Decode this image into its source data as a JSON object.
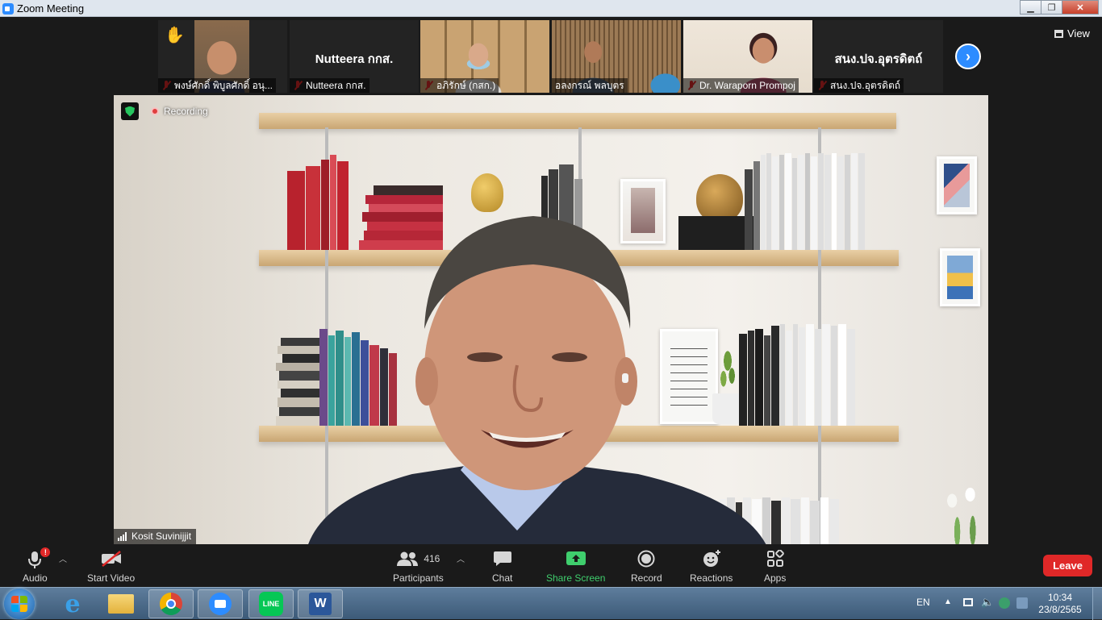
{
  "window": {
    "title": "Zoom Meeting",
    "min": "▁",
    "max": "❐",
    "close": "✕"
  },
  "gallery": {
    "tiles": [
      {
        "name": "พงษ์ศักดิ์ พิบูลศักดิ์ อนุ...",
        "type": "video",
        "hand_raised": true,
        "muted": true
      },
      {
        "name": "Nutteera กกส.",
        "display": "Nutteera กกส.",
        "type": "name",
        "muted": true
      },
      {
        "name": "อภิรักษ์ (กสก.)",
        "type": "video",
        "muted": true
      },
      {
        "name": "อลงกรณ์ พลบุตร",
        "type": "video",
        "muted": false
      },
      {
        "name": "Dr. Waraporn Prompoj",
        "type": "video",
        "muted": true
      },
      {
        "name": "สนง.ปจ.อุตรดิตถ์",
        "display": "สนง.ปจ.อุตรดิตถ์",
        "type": "name",
        "muted": true
      }
    ],
    "next_icon": "›",
    "view_label": "View"
  },
  "main_video": {
    "recording_label": "Recording",
    "speaker_name": "Kosit Suvinijjit"
  },
  "toolbar": {
    "audio": "Audio",
    "start_video": "Start Video",
    "participants": "Participants",
    "participants_count": "416",
    "chat": "Chat",
    "share_screen": "Share Screen",
    "record": "Record",
    "reactions": "Reactions",
    "apps": "Apps",
    "leave": "Leave",
    "audio_alert": "!"
  },
  "taskbar": {
    "apps": [
      "internet-explorer",
      "file-explorer",
      "chrome",
      "zoom",
      "line",
      "word"
    ],
    "line_label": "LINE",
    "word_label": "W",
    "lang": "EN",
    "time": "10:34",
    "date": "23/8/2565"
  },
  "colors": {
    "zoom_blue": "#2d8cff",
    "leave_red": "#e02828",
    "share_green": "#3fce6d",
    "mute_red": "#e02828",
    "toolbar_bg": "#1a1a1a"
  }
}
